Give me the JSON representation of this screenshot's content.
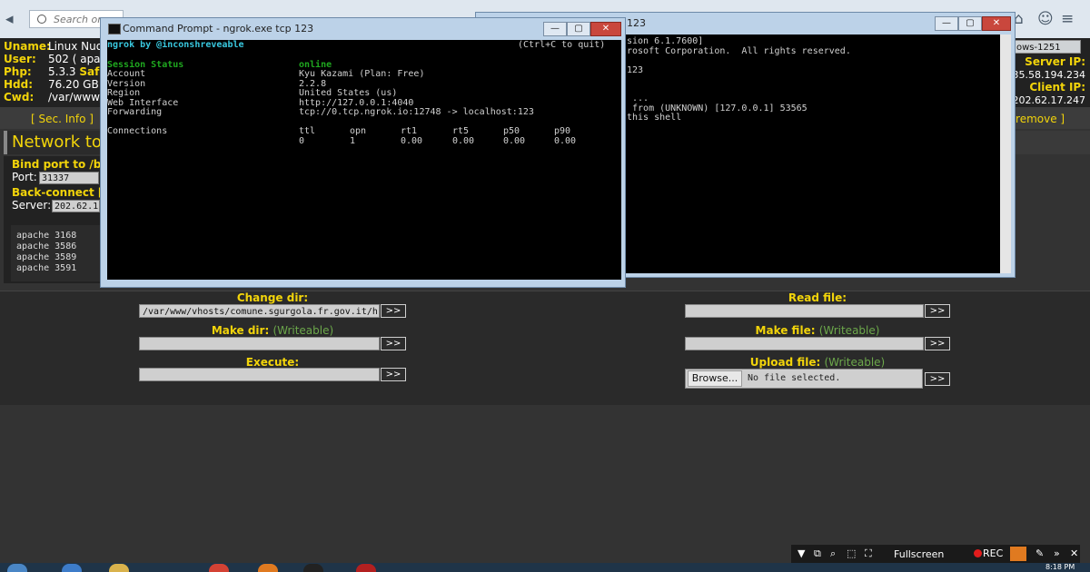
{
  "browser": {
    "search_placeholder": "Search or e",
    "icons": [
      "search-icon",
      "star-icon",
      "clipboard-icon",
      "download-icon",
      "home-icon",
      "chat-icon",
      "menu-icon"
    ]
  },
  "shell": {
    "labels": [
      "Uname:",
      "User:",
      "Php:",
      "Hdd:",
      "Cwd:"
    ],
    "uname": "Linux Nuov",
    "user": "502 ( apac",
    "php_version": "5.3.3",
    "php_safe": "Safe",
    "hdd": "76.20 GB",
    "cwd": "/var/www/",
    "os_box": "ows-1251",
    "server_ip_label": "Server IP:",
    "server_ip": "35.58.194.234",
    "client_ip_label": "Client IP:",
    "client_ip": "202.62.17.247",
    "sec_info": "[ Sec. Info ]",
    "self_remove": "f remove ]"
  },
  "network_tools": {
    "title": "Network too",
    "bind_label": "Bind port to /bin",
    "port_label": "Port:",
    "port_value": "31337",
    "back_connect_label": "Back-connect [p",
    "server_label": "Server:",
    "server_value": "202.62.1",
    "processes": [
      {
        "user": "apache",
        "pid": "3168"
      },
      {
        "user": "apache",
        "pid": "3586"
      },
      {
        "user": "apache",
        "pid": "3589"
      },
      {
        "user": "apache",
        "pid": "3591"
      }
    ]
  },
  "forms": {
    "change_dir_label": "Change dir:",
    "change_dir_value": "/var/www/vhosts/comune.sgurgola.fr.gov.it/h",
    "make_dir_label": "Make dir:",
    "writeable_note": "(Writeable)",
    "execute_label": "Execute:",
    "read_file_label": "Read file:",
    "make_file_label": "Make file:",
    "upload_file_label": "Upload file:",
    "go_label": ">>",
    "browse_label": "Browse...",
    "no_file_text": "No file selected."
  },
  "cmd_back": {
    "title": "123",
    "lines": [
      "sion 6.1.7600]",
      "rosoft Corporation.  All rights reserved.",
      "",
      "123",
      "",
      "",
      " ...",
      " from (UNKNOWN) [127.0.0.1] 53565",
      "this shell"
    ]
  },
  "cmd_front": {
    "title": "Command Prompt - ngrok.exe  tcp 123",
    "header_left": "ngrok by @inconshreveable",
    "header_right": "(Ctrl+C to quit)",
    "rows": [
      {
        "key": "Session Status",
        "value": "online"
      },
      {
        "key": "Account",
        "value": "Kyu Kazami (Plan: Free)"
      },
      {
        "key": "Version",
        "value": "2.2.8"
      },
      {
        "key": "Region",
        "value": "United States (us)"
      },
      {
        "key": "Web Interface",
        "value": "http://127.0.0.1:4040"
      },
      {
        "key": "Forwarding",
        "value": "tcp://0.tcp.ngrok.io:12748 -> localhost:123"
      }
    ],
    "connections_label": "Connections",
    "conn_headers": [
      "ttl",
      "opn",
      "rt1",
      "rt5",
      "p50",
      "p90"
    ],
    "conn_values": [
      "0",
      "1",
      "0.00",
      "0.00",
      "0.00",
      "0.00"
    ]
  },
  "window_buttons": {
    "minimize": "—",
    "maximize": "▢",
    "close": "✕"
  },
  "recorder": {
    "fullscreen_label": "Fullscreen",
    "rec_label": "REC"
  },
  "taskbar": {
    "clock": "8:18 PM"
  },
  "colors": {
    "accent_yellow": "#f2d40a",
    "note_green": "#6ca84b",
    "console_cyan": "#39c9e0",
    "console_green": "#1fa81f"
  }
}
